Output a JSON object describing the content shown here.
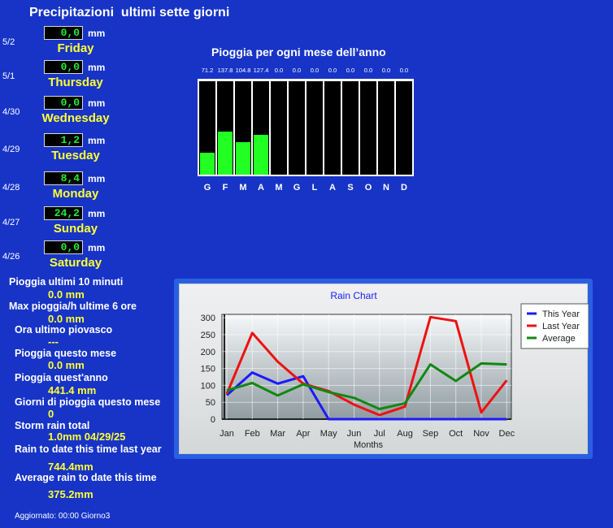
{
  "header": {
    "title": "Precipitazioni  ultimi sette giorni"
  },
  "days": [
    {
      "date": "5/2",
      "value": "0,0",
      "unit": "mm",
      "day": "Friday"
    },
    {
      "date": "5/1",
      "value": "0,0",
      "unit": "mm",
      "day": "Thursday"
    },
    {
      "date": "4/30",
      "value": "0,0",
      "unit": "mm",
      "day": "Wednesday"
    },
    {
      "date": "4/29",
      "value": "1,2",
      "unit": "mm",
      "day": "Tuesday"
    },
    {
      "date": "4/28",
      "value": "8,4",
      "unit": "mm",
      "day": "Monday"
    },
    {
      "date": "4/27",
      "value": "24,2",
      "unit": "mm",
      "day": "Sunday"
    },
    {
      "date": "4/26",
      "value": "0,0",
      "unit": "mm",
      "day": "Saturday"
    }
  ],
  "stats": [
    {
      "label": "Pioggia ultimi 10 minuti",
      "value": "0.0 mm"
    },
    {
      "label": "Max pioggia/h ultime 6 ore",
      "value": "0.0 mm"
    },
    {
      "label": "Ora ultimo piovasco",
      "value": "---"
    },
    {
      "label": "Pioggia questo mese",
      "value": "0.0 mm"
    },
    {
      "label": "Pioggia quest'anno",
      "value": "441.4 mm"
    },
    {
      "label": "Giorni di pioggia questo mese",
      "value": "0"
    },
    {
      "label": "Storm rain total",
      "value": "1.0mm 04/29/25"
    },
    {
      "label": "Rain to date this time last year",
      "value": "744.4mm"
    },
    {
      "label": "Average rain to date this time",
      "value": "375.2mm"
    }
  ],
  "footer": {
    "updated": "Aggiornato: 00:00 Giorno3"
  },
  "colors": {
    "background": "#1734c7",
    "highlight": "#ffff33",
    "bar": "#22ff22",
    "digits": "#22ee33"
  },
  "chart_data": [
    {
      "type": "bar",
      "title": "Pioggia per ogni mese dell’anno",
      "categories": [
        "G",
        "F",
        "M",
        "A",
        "M",
        "G",
        "L",
        "A",
        "S",
        "O",
        "N",
        "D"
      ],
      "values": [
        71.2,
        137.8,
        104.8,
        127.4,
        0.0,
        0.0,
        0.0,
        0.0,
        0.0,
        0.0,
        0.0,
        0.0
      ],
      "value_labels": [
        "71.2",
        "137.8",
        "104.8",
        "127.4",
        "0.0",
        "0.0",
        "0.0",
        "0.0",
        "0.0",
        "0.0",
        "0.0",
        "0.0"
      ],
      "ylim": [
        0,
        300
      ]
    },
    {
      "type": "line",
      "title": "Rain Chart",
      "xlabel": "Months",
      "ylabel": "",
      "categories": [
        "Jan",
        "Feb",
        "Mar",
        "Apr",
        "May",
        "Jun",
        "Jul",
        "Aug",
        "Sep",
        "Oct",
        "Nov",
        "Dec"
      ],
      "y_ticks": [
        "0",
        "50",
        "100",
        "150",
        "200",
        "250",
        "300"
      ],
      "ylim": [
        0,
        310
      ],
      "grid": true,
      "legend": "top-right",
      "series": [
        {
          "name": "This Year",
          "color": "#1a1aff",
          "values": [
            71,
            138,
            105,
            127,
            0,
            0,
            0,
            0,
            0,
            0,
            0,
            0
          ]
        },
        {
          "name": "Last Year",
          "color": "#ee1111",
          "values": [
            75,
            255,
            170,
            105,
            83,
            43,
            12,
            37,
            302,
            290,
            20,
            115
          ]
        },
        {
          "name": "Average",
          "color": "#118811",
          "values": [
            85,
            107,
            70,
            103,
            80,
            63,
            30,
            47,
            162,
            113,
            165,
            162
          ]
        }
      ]
    }
  ]
}
